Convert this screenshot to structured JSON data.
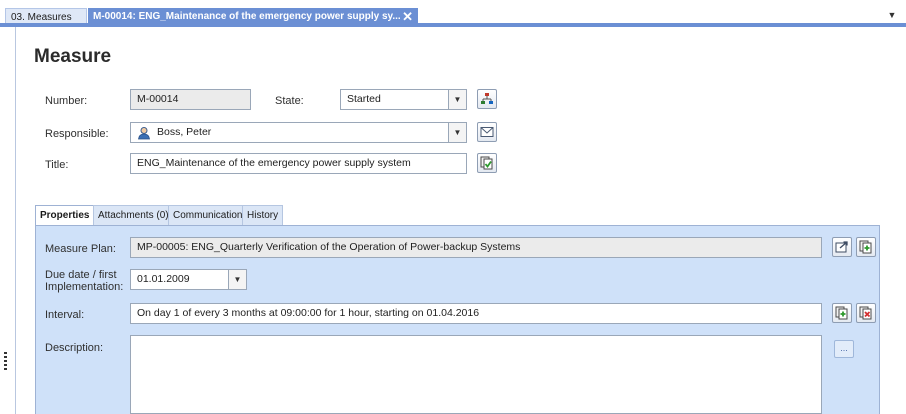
{
  "doc_tabs": {
    "inactive_label": "03. Measures",
    "active_label": "M-00014: ENG_Maintenance of the emergency power supply sy...",
    "close_glyph": "✕",
    "overflow_glyph": "▼"
  },
  "page_title": "Measure",
  "form": {
    "number_label": "Number:",
    "number_value": "M-00014",
    "state_label": "State:",
    "state_value": "Started",
    "responsible_label": "Responsible:",
    "responsible_value": "Boss, Peter",
    "title_label": "Title:",
    "title_value": "ENG_Maintenance of the emergency power supply system"
  },
  "inner_tabs": [
    {
      "label": "Properties",
      "selected": true
    },
    {
      "label": "Attachments (0)",
      "selected": false
    },
    {
      "label": "Communication",
      "selected": false
    },
    {
      "label": "History",
      "selected": false
    }
  ],
  "properties": {
    "measure_plan_label": "Measure Plan:",
    "measure_plan_value": "MP-00005: ENG_Quarterly Verification of the Operation of Power-backup Systems",
    "due_date_label_line1": "Due date / first",
    "due_date_label_line2": "Implementation:",
    "due_date_value": "01.01.2009",
    "interval_label": "Interval:",
    "interval_value": "On day 1 of every 3 months at 09:00:00 for 1 hour, starting on 01.04.2016",
    "description_label": "Description:",
    "description_value": "",
    "ellipsis_label": "..."
  },
  "combo_glyph": "▼",
  "icons": {
    "state_action": "workflow-icon",
    "responsible_action": "mail-icon",
    "title_action": "copy-check-icon",
    "plan_open": "open-link-icon",
    "plan_add": "add-document-icon",
    "interval_add": "add-document-icon",
    "interval_remove": "remove-document-icon"
  },
  "colors": {
    "accent": "#6b8fd4",
    "panel": "#cfe1f9",
    "tab_inactive": "#dbe6f6",
    "readonly_field": "#ebebeb"
  }
}
